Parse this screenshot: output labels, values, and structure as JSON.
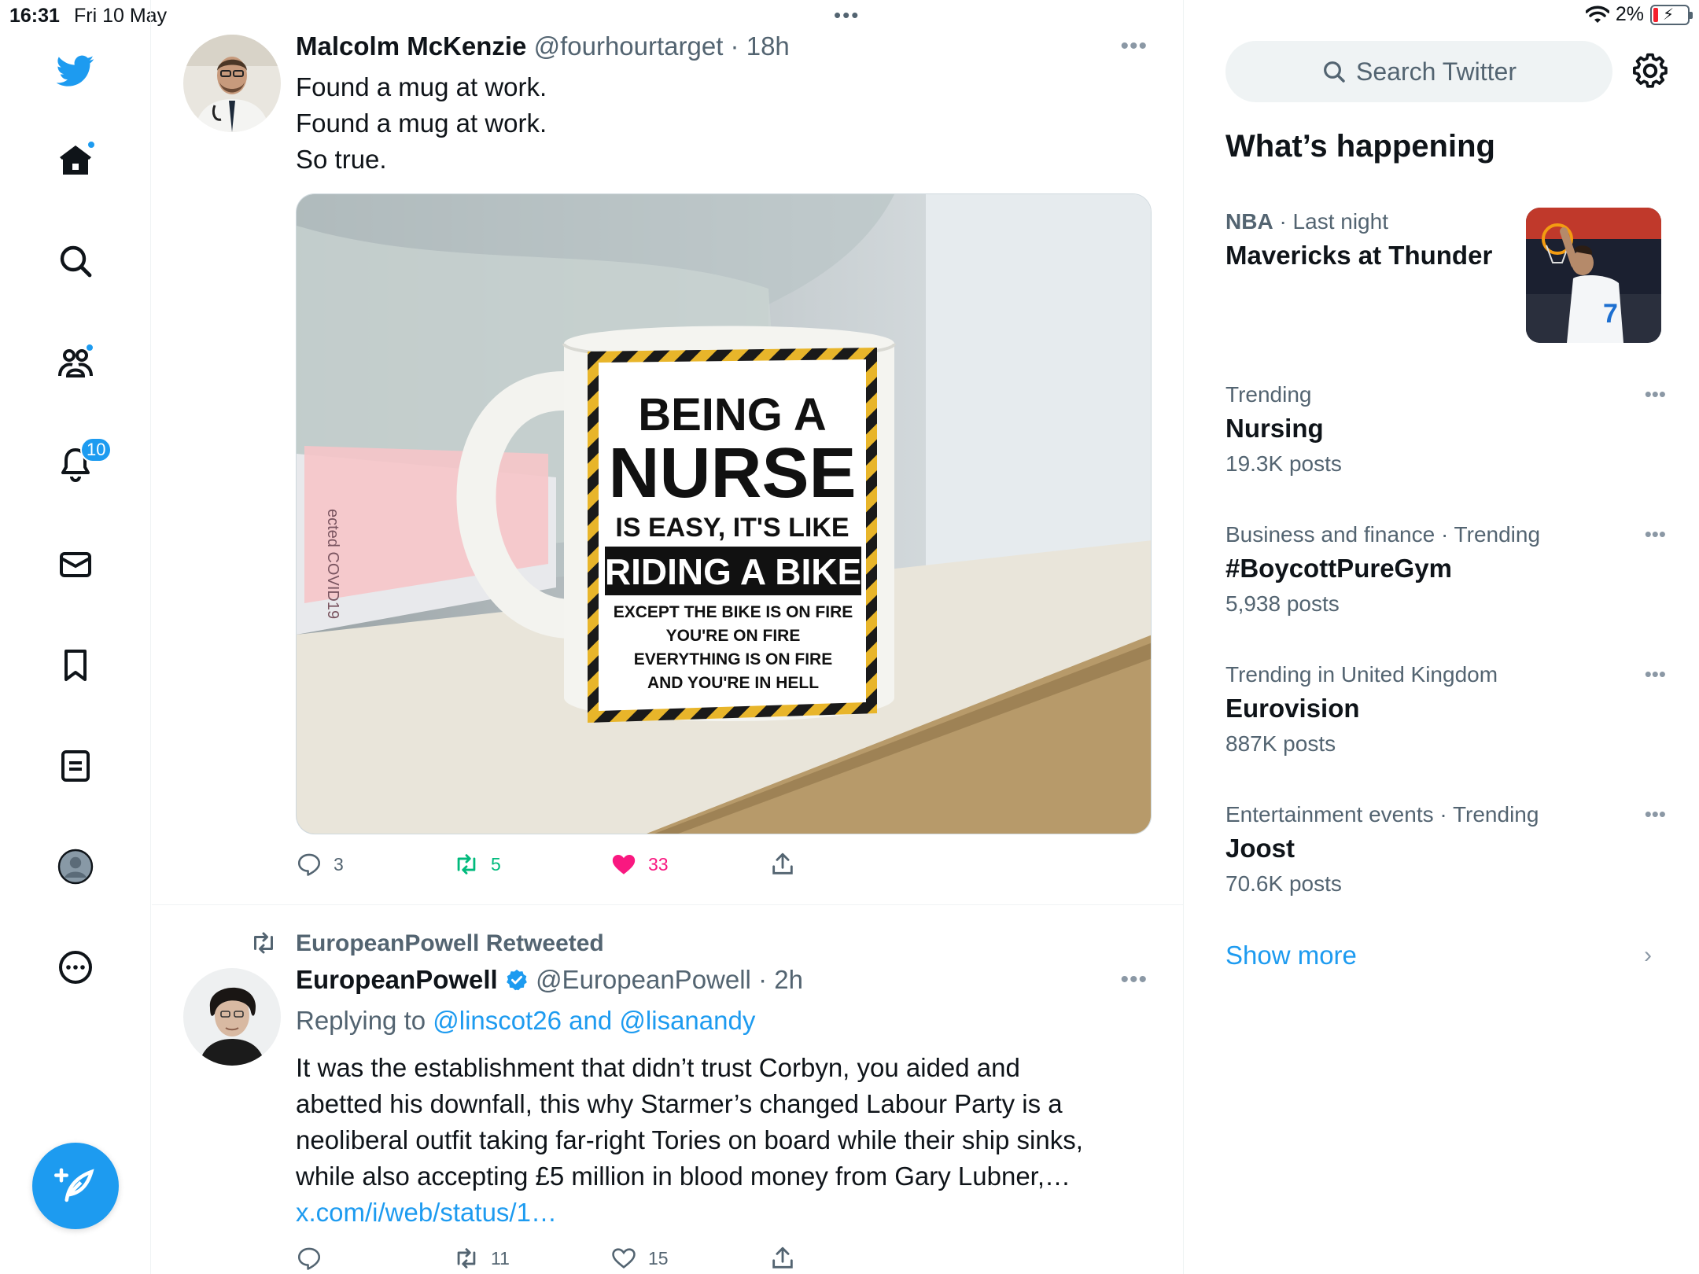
{
  "status_bar": {
    "time": "16:31",
    "date": "Fri 10 May",
    "battery": "2%"
  },
  "nav": {
    "notifications_count": "10",
    "icons": [
      "twitter-logo-icon",
      "home-icon",
      "explore-icon",
      "communities-icon",
      "notifications-icon",
      "messages-icon",
      "bookmarks-icon",
      "lists-icon",
      "profile-icon",
      "more-icon",
      "compose-icon"
    ]
  },
  "tweets": [
    {
      "name": "Malcolm McKenzie",
      "handle": "@fourhourtarget",
      "time": "18h",
      "lines": [
        "Found a mug at work.",
        "Found a mug at work.",
        "So true."
      ],
      "media": {
        "line1": "BEING A",
        "line2": "NURSE",
        "line3": "IS EASY, IT'S LIKE",
        "line4": "RIDING A BIKE",
        "line5": "EXCEPT THE BIKE IS ON FIRE",
        "line6": "YOU'RE ON FIRE",
        "line7": "EVERYTHING IS ON FIRE",
        "line8": "AND YOU'RE IN HELL",
        "poster_text": "ected COVID19"
      },
      "replies": "3",
      "retweets": "5",
      "likes": "33"
    },
    {
      "retweeted_by": "EuropeanPowell Retweeted",
      "name": "EuropeanPowell",
      "handle": "@EuropeanPowell",
      "time": "2h",
      "replying_prefix": "Replying to ",
      "replying_to": "@linscot26 and @lisanandy",
      "lines": [
        "It was the establishment that didn’t trust Corbyn, you aided and",
        "abetted his downfall, this why  Starmer’s changed Labour Party is a",
        "neoliberal outfit taking far-right Tories on board while their ship sinks,",
        "while also accepting £5 million in blood money from Gary Lubner,…"
      ],
      "link": "x.com/i/web/status/1…",
      "replies": "",
      "retweets": "11",
      "likes": "15"
    }
  ],
  "sidebar": {
    "search_placeholder": "Search Twitter",
    "title": "What’s happening",
    "trends": [
      {
        "category": "NBA",
        "category_suffix": " · Last night",
        "topic": "Mavericks at Thunder",
        "count": ""
      },
      {
        "category": "Trending",
        "topic": "Nursing",
        "count": "19.3K posts"
      },
      {
        "category": "Business and finance · Trending",
        "topic": "#BoycottPureGym",
        "count": "5,938 posts"
      },
      {
        "category": "Trending in United Kingdom",
        "topic": "Eurovision",
        "count": "887K posts"
      },
      {
        "category": "Entertainment events · Trending",
        "topic": "Joost",
        "count": "70.6K posts"
      }
    ],
    "show_more": "Show more",
    "jersey_number": "7"
  },
  "colors": {
    "accent": "#1d9bf0",
    "like": "#f91880",
    "retweet": "#00ba7c",
    "muted": "#536471"
  }
}
